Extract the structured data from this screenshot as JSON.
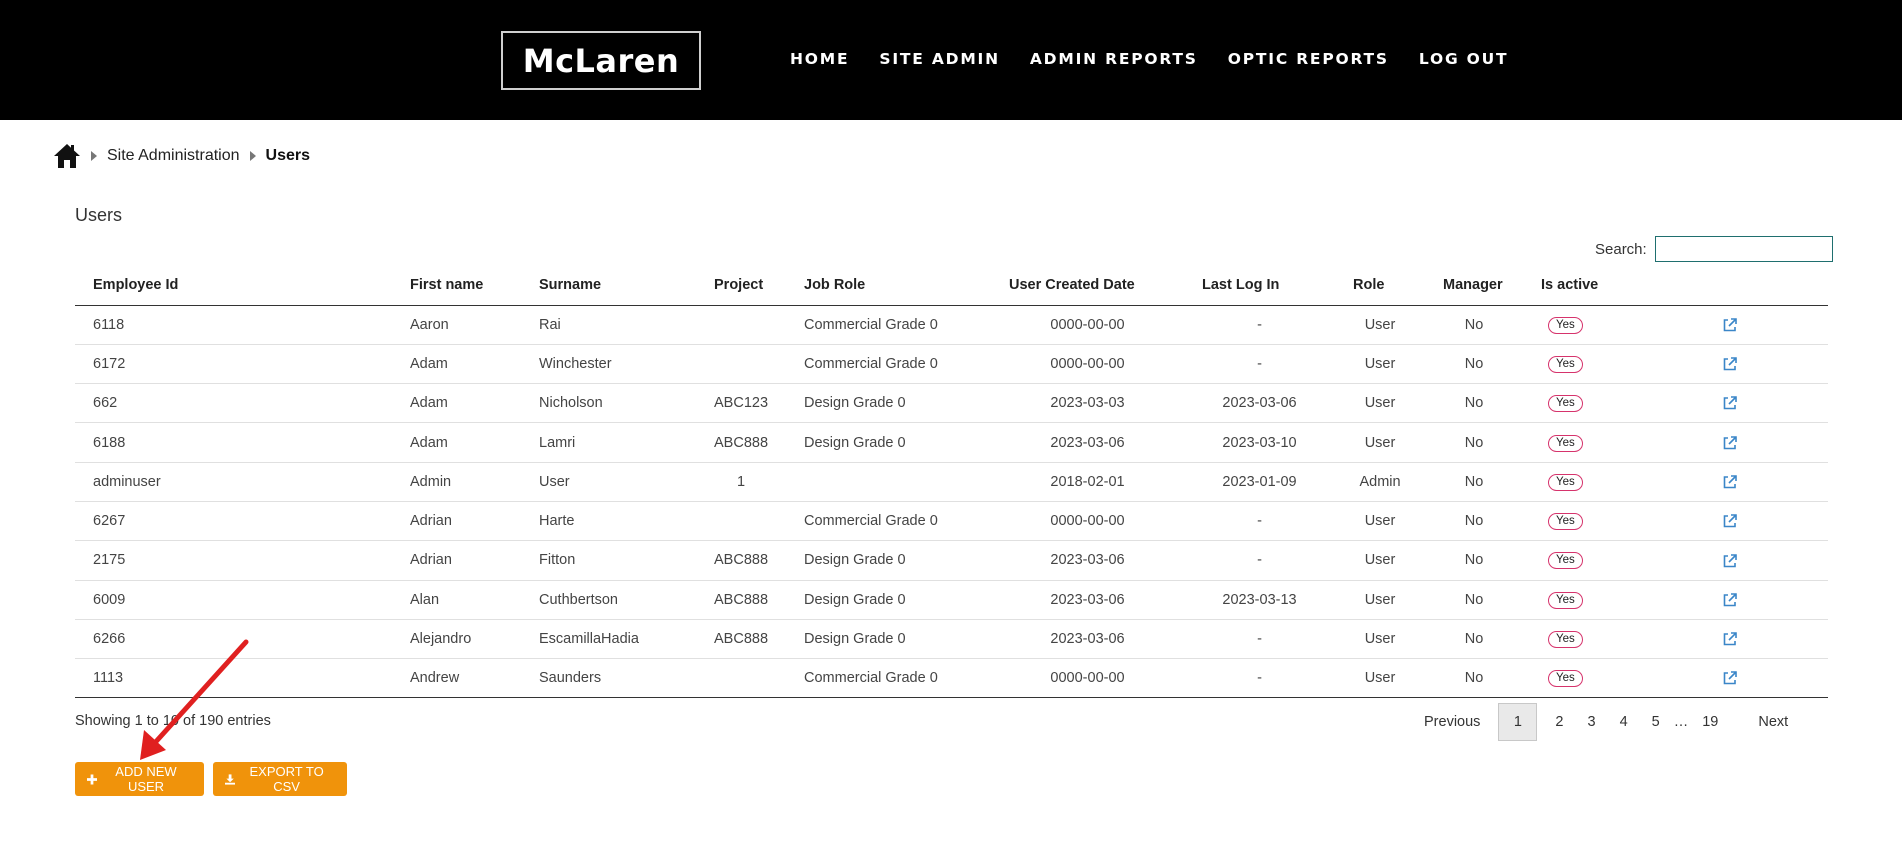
{
  "header": {
    "logo_text": "McLaren",
    "nav": [
      "HOME",
      "SITE ADMIN",
      "ADMIN REPORTS",
      "OPTIC REPORTS",
      "LOG OUT"
    ]
  },
  "breadcrumb": {
    "icon": "home-icon",
    "items": [
      "Site Administration",
      "Users"
    ]
  },
  "page": {
    "title": "Users",
    "search_label": "Search:",
    "search_value": ""
  },
  "table": {
    "columns": [
      "Employee Id",
      "First name",
      "Surname",
      "Project",
      "Job Role",
      "User Created Date",
      "Last Log In",
      "Role",
      "Manager",
      "Is active",
      ""
    ],
    "rows": [
      [
        "6118",
        "Aaron",
        "Rai",
        "",
        "Commercial Grade 0",
        "0000-00-00",
        "-",
        "User",
        "No",
        "Yes"
      ],
      [
        "6172",
        "Adam",
        "Winchester",
        "",
        "Commercial Grade 0",
        "0000-00-00",
        "-",
        "User",
        "No",
        "Yes"
      ],
      [
        "662",
        "Adam",
        "Nicholson",
        "ABC123",
        "Design Grade 0",
        "2023-03-03",
        "2023-03-06",
        "User",
        "No",
        "Yes"
      ],
      [
        "6188",
        "Adam",
        "Lamri",
        "ABC888",
        "Design Grade 0",
        "2023-03-06",
        "2023-03-10",
        "User",
        "No",
        "Yes"
      ],
      [
        "adminuser",
        "Admin",
        "User",
        "1",
        "",
        "2018-02-01",
        "2023-01-09",
        "Admin",
        "No",
        "Yes"
      ],
      [
        "6267",
        "Adrian",
        "Harte",
        "",
        "Commercial Grade 0",
        "0000-00-00",
        "-",
        "User",
        "No",
        "Yes"
      ],
      [
        "2175",
        "Adrian",
        "Fitton",
        "ABC888",
        "Design Grade 0",
        "2023-03-06",
        "-",
        "User",
        "No",
        "Yes"
      ],
      [
        "6009",
        "Alan",
        "Cuthbertson",
        "ABC888",
        "Design Grade 0",
        "2023-03-06",
        "2023-03-13",
        "User",
        "No",
        "Yes"
      ],
      [
        "6266",
        "Alejandro",
        "EscamillaHadia",
        "ABC888",
        "Design Grade 0",
        "2023-03-06",
        "-",
        "User",
        "No",
        "Yes"
      ],
      [
        "1113",
        "Andrew",
        "Saunders",
        "",
        "Commercial Grade 0",
        "0000-00-00",
        "-",
        "User",
        "No",
        "Yes"
      ]
    ],
    "row_action_icon": "external-link-icon"
  },
  "footer": {
    "info": "Showing 1 to 10 of 190 entries",
    "pagination": {
      "previous": "Previous",
      "pages": [
        "1",
        "2",
        "3",
        "4",
        "5"
      ],
      "ellipsis": "…",
      "last": "19",
      "next": "Next",
      "current": "1"
    },
    "buttons": {
      "add_label": "ADD NEW USER",
      "export_label": "EXPORT TO CSV"
    }
  },
  "colors": {
    "header_bg": "#000000",
    "button_orange": "#f0930b",
    "badge_border": "#d6336c",
    "link_blue": "#3a86c8",
    "annotation_arrow": "#e02020"
  }
}
